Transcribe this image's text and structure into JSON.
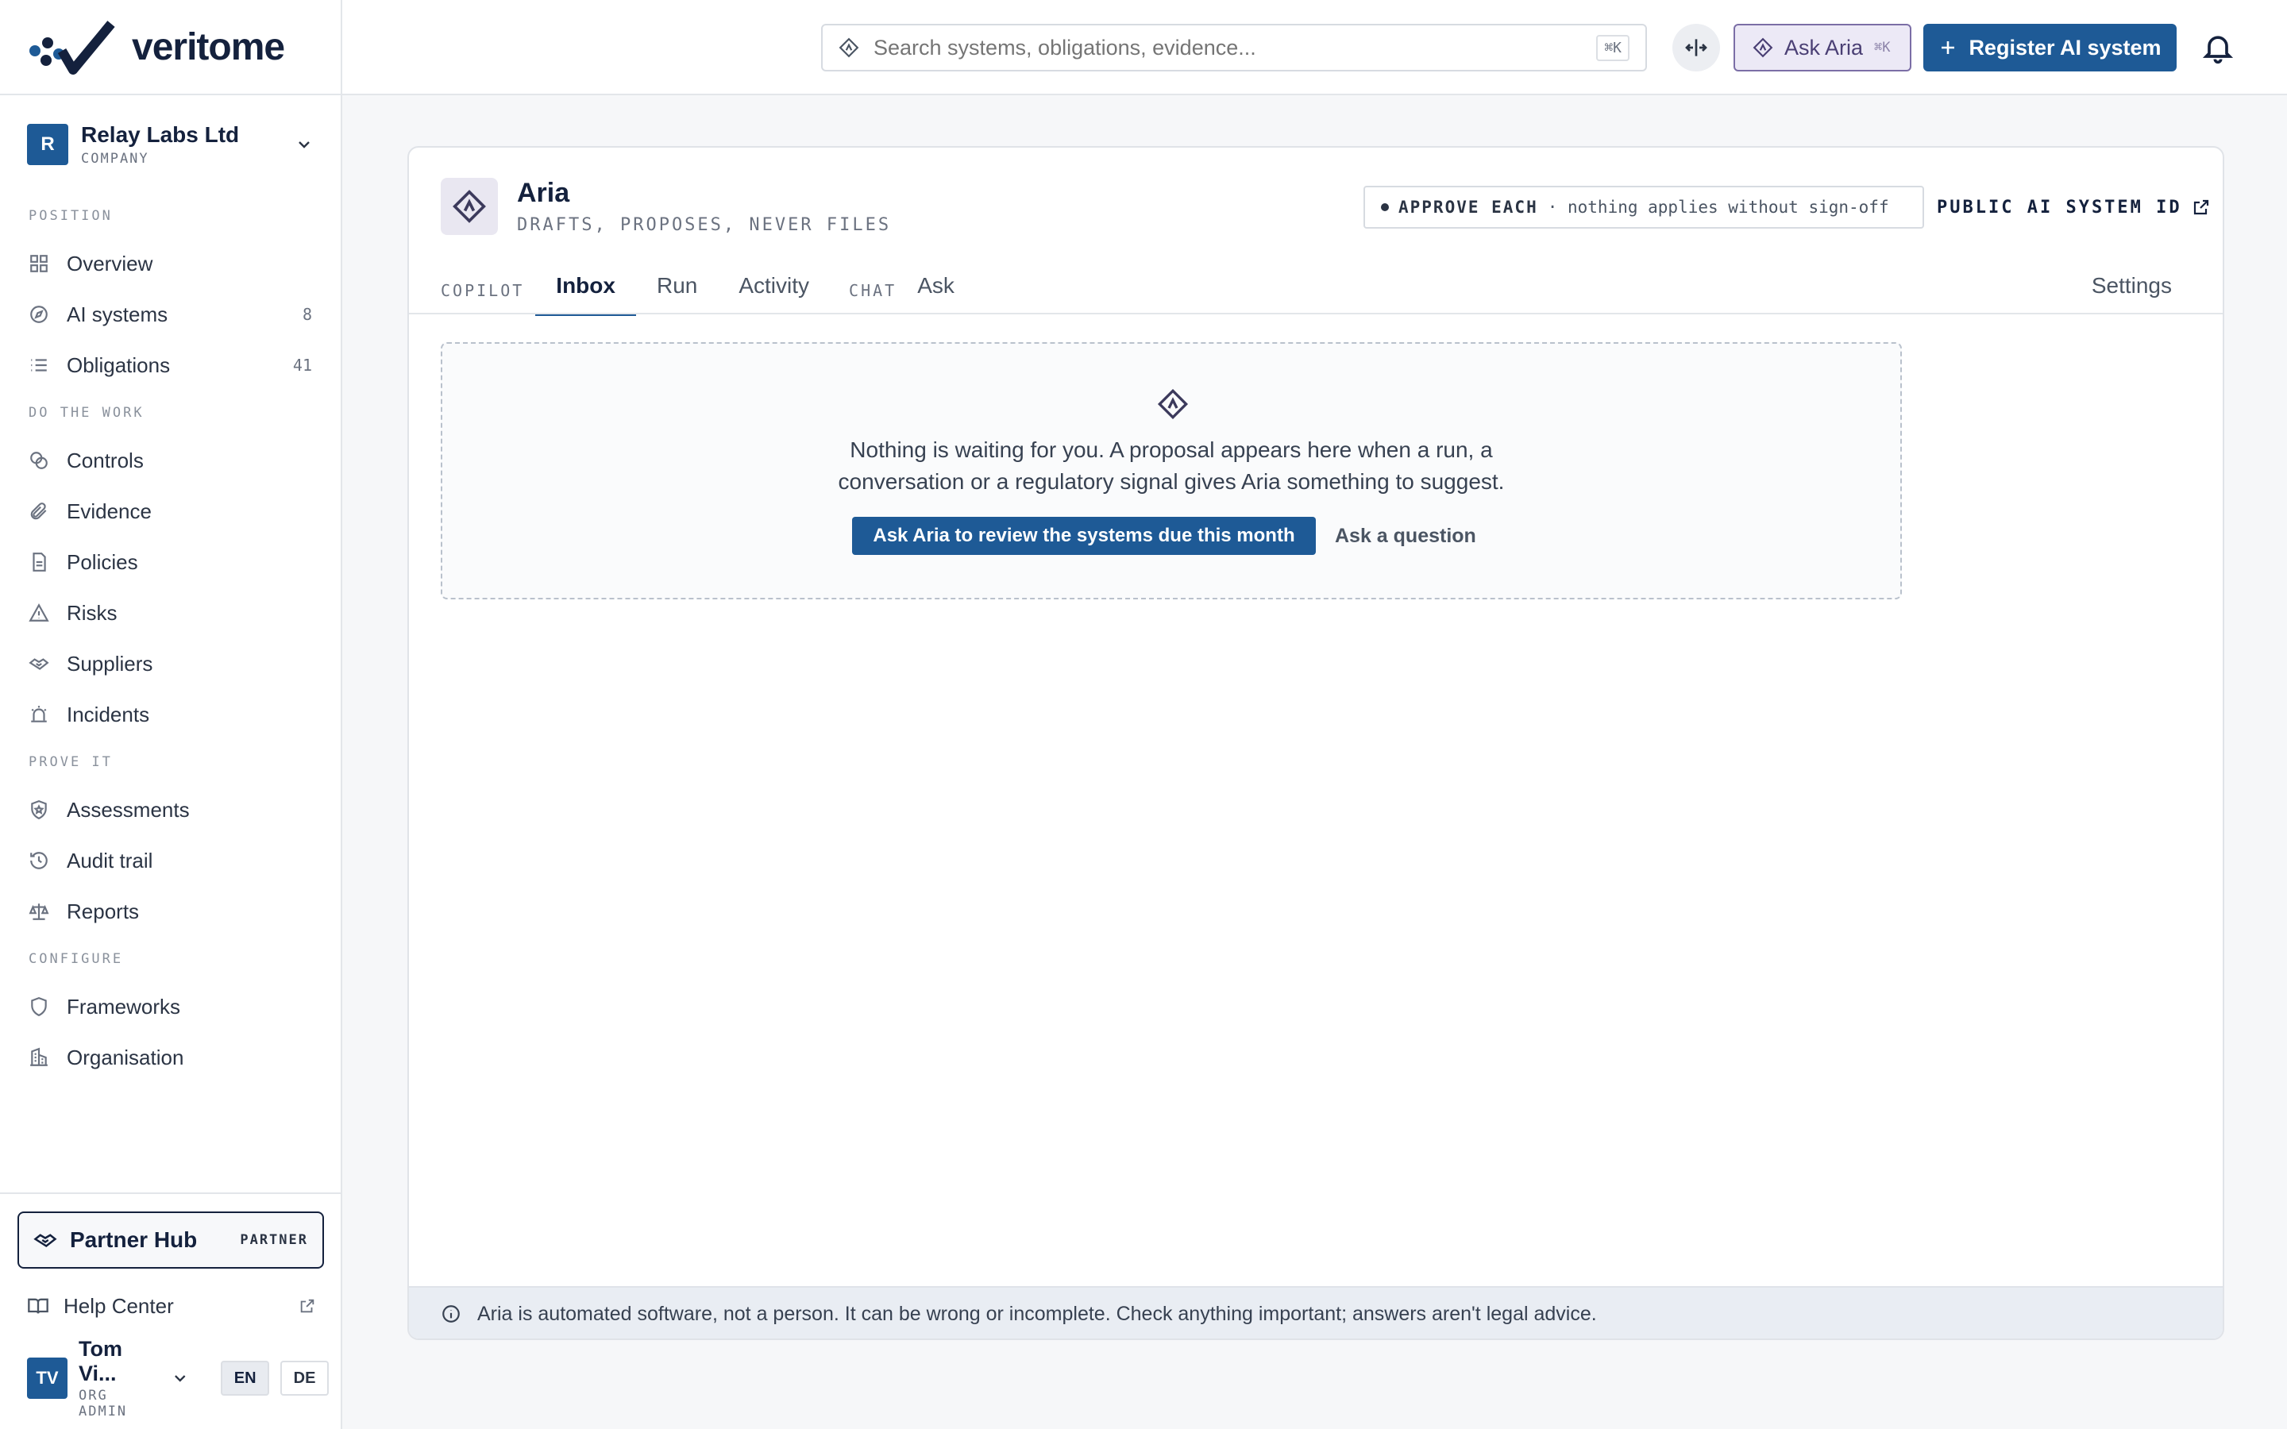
{
  "brand": {
    "name": "veritome"
  },
  "org": {
    "initial": "R",
    "name": "Relay Labs Ltd",
    "type": "COMPANY"
  },
  "nav": {
    "sections": {
      "position": "POSITION",
      "work": "DO THE WORK",
      "prove": "PROVE IT",
      "configure": "CONFIGURE"
    },
    "items": {
      "overview": {
        "label": "Overview"
      },
      "ai_systems": {
        "label": "AI systems",
        "count": "8"
      },
      "obligations": {
        "label": "Obligations",
        "count": "41"
      },
      "controls": {
        "label": "Controls"
      },
      "evidence": {
        "label": "Evidence"
      },
      "policies": {
        "label": "Policies"
      },
      "risks": {
        "label": "Risks"
      },
      "suppliers": {
        "label": "Suppliers"
      },
      "incidents": {
        "label": "Incidents"
      },
      "assessments": {
        "label": "Assessments"
      },
      "audit_trail": {
        "label": "Audit trail"
      },
      "reports": {
        "label": "Reports"
      },
      "frameworks": {
        "label": "Frameworks"
      },
      "organisation": {
        "label": "Organisation"
      }
    }
  },
  "partner_hub": {
    "label": "Partner Hub",
    "tag": "PARTNER"
  },
  "help_center": {
    "label": "Help Center"
  },
  "user": {
    "initials": "TV",
    "name": "Tom Vi...",
    "role": "ORG ADMIN"
  },
  "languages": {
    "en": "EN",
    "de": "DE",
    "active": "EN"
  },
  "topbar": {
    "search_placeholder": "Search systems, obligations, evidence...",
    "search_shortcut": "⌘K",
    "ask_aria": "Ask Aria",
    "ask_aria_shortcut": "⌘K",
    "register": "Register AI system"
  },
  "aria": {
    "name": "Aria",
    "subtitle": "DRAFTS, PROPOSES, NEVER FILES",
    "approve_mode": "APPROVE EACH",
    "approve_note": "· nothing applies without sign-off",
    "public_id": "PUBLIC AI SYSTEM ID"
  },
  "tabs": {
    "group_copilot": "COPILOT",
    "inbox": "Inbox",
    "run": "Run",
    "activity": "Activity",
    "group_chat": "CHAT",
    "ask": "Ask",
    "settings": "Settings",
    "active": "Inbox"
  },
  "inbox_empty": {
    "line1": "Nothing is waiting for you. A proposal appears here when a run, a",
    "line2": "conversation or a regulatory signal gives Aria something to suggest.",
    "primary_action": "Ask Aria to review the systems due this month",
    "secondary_action": "Ask a question"
  },
  "disclaimer": "Aria is automated software, not a person. It can be wrong or incomplete. Check anything important; answers aren't legal advice.",
  "colors": {
    "accent": "#1e5a96",
    "aria_tint": "#ece9f6",
    "aria_border": "#7b6ea6"
  }
}
